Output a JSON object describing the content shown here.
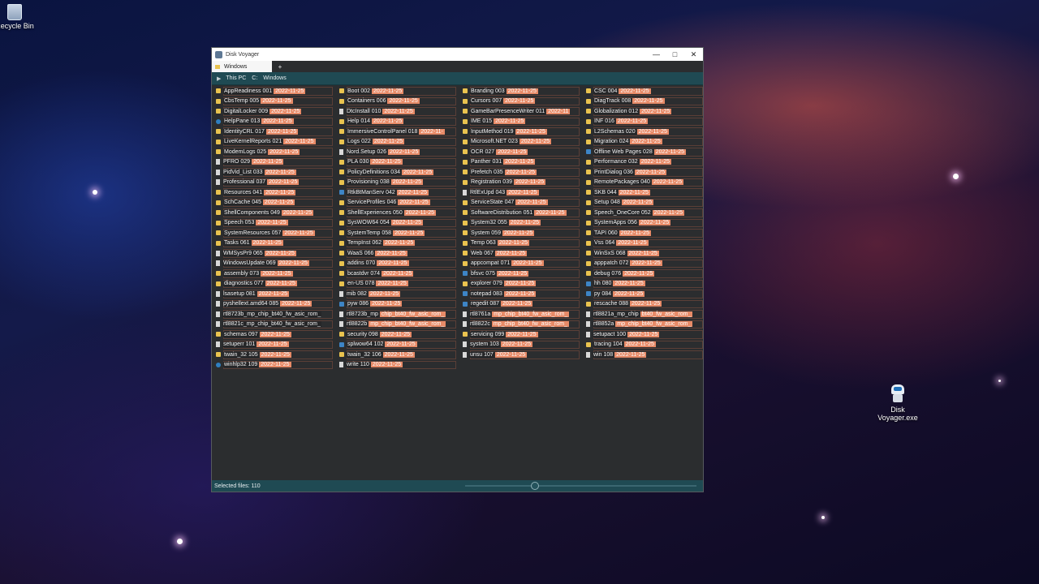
{
  "window": {
    "title": "Disk Voyager"
  },
  "titlebar_buttons": {
    "minimize": "—",
    "maximize": "□",
    "close": "✕"
  },
  "tabs": [
    {
      "label": "Windows"
    }
  ],
  "tab_add": "+",
  "breadcrumb": {
    "play": "▶",
    "items": [
      "This PC",
      "C:",
      "Windows"
    ]
  },
  "status": {
    "selected": "Selected files: 110",
    "zoom_fraction": 0.3
  },
  "desktop": {
    "recycle_bin": "Recycle Bin",
    "app_icon_line1": "Disk",
    "app_icon_line2": "Voyager.exe"
  },
  "columns": [
    [
      {
        "name": "AppReadiness 001",
        "date": "2022-11-25",
        "icon": "folder"
      },
      {
        "name": "CbsTemp 005",
        "date": "2022-11-25",
        "icon": "folder"
      },
      {
        "name": "DigitalLocker 009",
        "date": "2022-11-25",
        "icon": "folder"
      },
      {
        "name": "HelpPane 013",
        "date": "2022-11-25",
        "icon": "help"
      },
      {
        "name": "IdentityCRL 017",
        "date": "2022-11-25",
        "icon": "folder"
      },
      {
        "name": "LiveKernelReports 021",
        "date": "2022-11-25",
        "icon": "folder"
      },
      {
        "name": "ModemLogs 025",
        "date": "2022-11-25",
        "icon": "folder"
      },
      {
        "name": "PFRO 029",
        "date": "2022-11-25",
        "icon": "file"
      },
      {
        "name": "PidVid_List 033",
        "date": "2022-11-25",
        "icon": "file"
      },
      {
        "name": "Professional 037",
        "date": "2022-11-25",
        "icon": "file"
      },
      {
        "name": "Resources 041",
        "date": "2022-11-25",
        "icon": "folder"
      },
      {
        "name": "SchCache 045",
        "date": "2022-11-25",
        "icon": "folder"
      },
      {
        "name": "ShellComponents 049",
        "date": "2022-11-25",
        "icon": "folder"
      },
      {
        "name": "Speech 053",
        "date": "2022-11-25",
        "icon": "folder"
      },
      {
        "name": "SystemResources 057",
        "date": "2022-11-25",
        "icon": "folder"
      },
      {
        "name": "Tasks 061",
        "date": "2022-11-25",
        "icon": "folder"
      },
      {
        "name": "WMSysPr9 065",
        "date": "2022-11-25",
        "icon": "file"
      },
      {
        "name": "WindowsUpdate 069",
        "date": "2022-11-25",
        "icon": "file"
      },
      {
        "name": "assembly 073",
        "date": "2022-11-25",
        "icon": "folder"
      },
      {
        "name": "diagnostics 077",
        "date": "2022-11-25",
        "icon": "folder"
      },
      {
        "name": "lsasetup 081",
        "date": "2022-11-25",
        "icon": "file"
      },
      {
        "name": "pyshellext.amd64 085",
        "date": "2022-11-25",
        "icon": "file"
      },
      {
        "name": "rtl8723b_mp_chip_bt40_fw_asic_rom_",
        "date": "",
        "icon": "file"
      },
      {
        "name": "rtl8821c_mp_chip_bt40_fw_asic_rom_",
        "date": "",
        "icon": "file"
      },
      {
        "name": "schemas 097",
        "date": "2022-11-25",
        "icon": "folder"
      },
      {
        "name": "setuperr 101",
        "date": "2022-11-25",
        "icon": "file"
      },
      {
        "name": "twain_32 105",
        "date": "2022-11-25",
        "icon": "folder"
      },
      {
        "name": "winhlp32 109",
        "date": "2022-11-25",
        "icon": "help"
      }
    ],
    [
      {
        "name": "Boot 002",
        "date": "2022-11-25",
        "icon": "folder"
      },
      {
        "name": "Containers 006",
        "date": "2022-11-25",
        "icon": "folder"
      },
      {
        "name": "DtcInstall 010",
        "date": "2022-11-25",
        "icon": "file"
      },
      {
        "name": "Help 014",
        "date": "2022-11-25",
        "icon": "folder"
      },
      {
        "name": "ImmersiveControlPanel 018",
        "date": "2022-11-",
        "icon": "folder"
      },
      {
        "name": "Logs 022",
        "date": "2022-11-25",
        "icon": "folder"
      },
      {
        "name": "Nord.Setup 026",
        "date": "2022-11-25",
        "icon": "file"
      },
      {
        "name": "PLA 030",
        "date": "2022-11-25",
        "icon": "folder"
      },
      {
        "name": "PolicyDefinitions 034",
        "date": "2022-11-25",
        "icon": "folder"
      },
      {
        "name": "Provisioning 038",
        "date": "2022-11-25",
        "icon": "folder"
      },
      {
        "name": "RtkBtManServ 042",
        "date": "2022-11-25",
        "icon": "app"
      },
      {
        "name": "ServiceProfiles 046",
        "date": "2022-11-25",
        "icon": "folder"
      },
      {
        "name": "ShellExperiences 050",
        "date": "2022-11-25",
        "icon": "folder"
      },
      {
        "name": "SysWOW64 054",
        "date": "2022-11-25",
        "icon": "folder"
      },
      {
        "name": "SystemTemp 058",
        "date": "2022-11-25",
        "icon": "folder"
      },
      {
        "name": "TempInst 062",
        "date": "2022-11-25",
        "icon": "folder"
      },
      {
        "name": "WaaS 066",
        "date": "2022-11-25",
        "icon": "folder"
      },
      {
        "name": "addins 070",
        "date": "2022-11-25",
        "icon": "folder"
      },
      {
        "name": "bcastdvr 074",
        "date": "2022-11-25",
        "icon": "folder"
      },
      {
        "name": "en-US 078",
        "date": "2022-11-25",
        "icon": "folder"
      },
      {
        "name": "mib 082",
        "date": "2022-11-25",
        "icon": "file"
      },
      {
        "name": "pyw 086",
        "date": "2022-11-25",
        "icon": "app"
      },
      {
        "name": "rtl8723b_mp",
        "date": "chip_bt40_fw_asic_rom_",
        "icon": "file"
      },
      {
        "name": "rtl8822b",
        "date": "mp_chip_bt40_fw_asic_rom_",
        "icon": "file"
      },
      {
        "name": "security 098",
        "date": "2022-11-25",
        "icon": "folder"
      },
      {
        "name": "splwow64 102",
        "date": "2022-11-25",
        "icon": "app"
      },
      {
        "name": "twain_32 106",
        "date": "2022-11-25",
        "icon": "folder"
      },
      {
        "name": "write 110",
        "date": "2022-11-25",
        "icon": "file"
      }
    ],
    [
      {
        "name": "Branding 003",
        "date": "2022-11-25",
        "icon": "folder"
      },
      {
        "name": "Cursors 007",
        "date": "2022-11-25",
        "icon": "folder"
      },
      {
        "name": "GameBarPresenceWriter 011",
        "date": "2022-11",
        "icon": "folder"
      },
      {
        "name": "IME 015",
        "date": "2022-11-25",
        "icon": "folder"
      },
      {
        "name": "InputMethod 019",
        "date": "2022-11-25",
        "icon": "folder"
      },
      {
        "name": "Microsoft.NET 023",
        "date": "2022-11-25",
        "icon": "folder"
      },
      {
        "name": "OCR 027",
        "date": "2022-11-25",
        "icon": "folder"
      },
      {
        "name": "Panther 031",
        "date": "2022-11-25",
        "icon": "folder"
      },
      {
        "name": "Prefetch 035",
        "date": "2022-11-25",
        "icon": "folder"
      },
      {
        "name": "Registration 039",
        "date": "2022-11-25",
        "icon": "folder"
      },
      {
        "name": "RtlExUpd 043",
        "date": "2022-11-25",
        "icon": "file"
      },
      {
        "name": "ServiceState 047",
        "date": "2022-11-25",
        "icon": "folder"
      },
      {
        "name": "SoftwareDistribution 051",
        "date": "2022-11-25",
        "icon": "folder"
      },
      {
        "name": "System32 055",
        "date": "2022-11-25",
        "icon": "folder"
      },
      {
        "name": "System 059",
        "date": "2022-11-25",
        "icon": "folder"
      },
      {
        "name": "Temp 063",
        "date": "2022-11-25",
        "icon": "folder"
      },
      {
        "name": "Web 067",
        "date": "2022-11-25",
        "icon": "folder"
      },
      {
        "name": "appcompat 071",
        "date": "2022-11-25",
        "icon": "folder"
      },
      {
        "name": "bfsvc 075",
        "date": "2022-11-25",
        "icon": "app"
      },
      {
        "name": "explorer 079",
        "date": "2022-11-25",
        "icon": "folder"
      },
      {
        "name": "notepad 083",
        "date": "2022-11-25",
        "icon": "app"
      },
      {
        "name": "regedit 087",
        "date": "2022-11-25",
        "icon": "app"
      },
      {
        "name": "rtl8761a",
        "date": "mp_chip_bt40_fw_asic_rom_",
        "icon": "file"
      },
      {
        "name": "rtl8822c",
        "date": "mp_chip_bt40_fw_asic_rom_",
        "icon": "file"
      },
      {
        "name": "servicing 099",
        "date": "2022-11-25",
        "icon": "folder"
      },
      {
        "name": "system 103",
        "date": "2022-11-25",
        "icon": "file"
      },
      {
        "name": "unsu 107",
        "date": "2022-11-25",
        "icon": "file"
      }
    ],
    [
      {
        "name": "CSC 004",
        "date": "2022-11-25",
        "icon": "folder"
      },
      {
        "name": "DiagTrack 008",
        "date": "2022-11-25",
        "icon": "folder"
      },
      {
        "name": "Globalization 012",
        "date": "2022-11-25",
        "icon": "folder"
      },
      {
        "name": "INF 016",
        "date": "2022-11-25",
        "icon": "folder"
      },
      {
        "name": "L2Schemas 020",
        "date": "2022-11-25",
        "icon": "folder"
      },
      {
        "name": "Migration 024",
        "date": "2022-11-25",
        "icon": "folder"
      },
      {
        "name": "Offline Web Pages 028",
        "date": "2022-11-25",
        "icon": "app"
      },
      {
        "name": "Performance 032",
        "date": "2022-11-25",
        "icon": "folder"
      },
      {
        "name": "PrintDialog 036",
        "date": "2022-11-25",
        "icon": "folder"
      },
      {
        "name": "RemotePackages 040",
        "date": "2022-11-25",
        "icon": "folder"
      },
      {
        "name": "SKB 044",
        "date": "2022-11-25",
        "icon": "folder"
      },
      {
        "name": "Setup 048",
        "date": "2022-11-25",
        "icon": "folder"
      },
      {
        "name": "Speech_OneCore 052",
        "date": "2022-11-25",
        "icon": "folder"
      },
      {
        "name": "SystemApps 056",
        "date": "2022-11-25",
        "icon": "folder"
      },
      {
        "name": "TAPI 060",
        "date": "2022-11-25",
        "icon": "folder"
      },
      {
        "name": "Vss 064",
        "date": "2022-11-25",
        "icon": "folder"
      },
      {
        "name": "WinSxS 068",
        "date": "2022-11-25",
        "icon": "folder"
      },
      {
        "name": "apppatch 072",
        "date": "2022-11-25",
        "icon": "folder"
      },
      {
        "name": "debug 076",
        "date": "2022-11-25",
        "icon": "folder"
      },
      {
        "name": "hh 080",
        "date": "2022-11-25",
        "icon": "app"
      },
      {
        "name": "py 084",
        "date": "2022-11-25",
        "icon": "app"
      },
      {
        "name": "rescache 088",
        "date": "2022-11-25",
        "icon": "folder"
      },
      {
        "name": "rtl8821a_mp_chip",
        "date": "bt40_fw_asic_rom_",
        "icon": "file"
      },
      {
        "name": "rtl8852a",
        "date": "mp_chip_bt40_fw_asic_rom_",
        "icon": "file"
      },
      {
        "name": "setupact 100",
        "date": "2022-11-25",
        "icon": "file"
      },
      {
        "name": "tracing 104",
        "date": "2022-11-25",
        "icon": "folder"
      },
      {
        "name": "win 108",
        "date": "2022-11-25",
        "icon": "file"
      }
    ]
  ]
}
